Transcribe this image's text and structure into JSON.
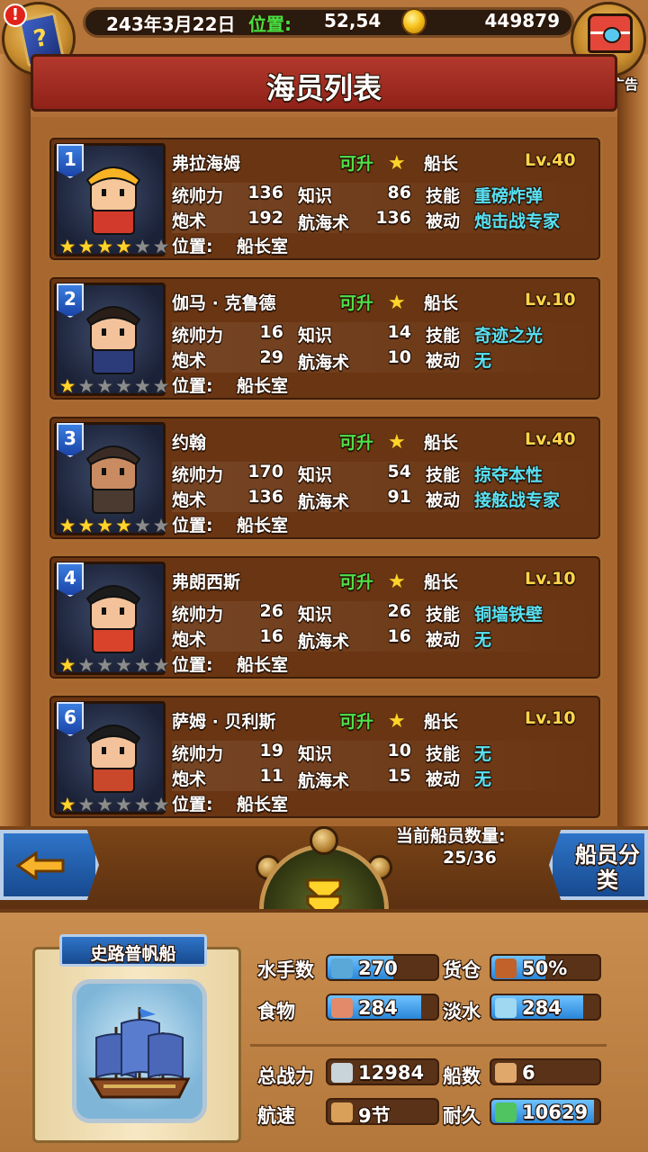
{
  "header": {
    "date": "243年3月22日",
    "position_label": "位置:",
    "position_value": "52,54",
    "gold": "449879",
    "ad_label": "有新广告",
    "alert": "!",
    "book_glyph": "?"
  },
  "title": "海员列表",
  "crew": [
    {
      "number": "1",
      "name": "弗拉海姆",
      "upgrade": "可升",
      "role": "船长",
      "level": "Lv.40",
      "stars": 4,
      "max_stars": 6,
      "command_label": "统帅力",
      "command": "136",
      "knowledge_label": "知识",
      "knowledge": "86",
      "skill_label": "技能",
      "skill": "重磅炸弹",
      "gunnery_label": "炮术",
      "gunnery": "192",
      "navigation_label": "航海术",
      "navigation": "136",
      "passive_label": "被动",
      "passive": "炮击战专家",
      "location_label": "位置:",
      "location": "船长室",
      "hair": "#f7b323",
      "skin": "#f6c79a",
      "outfit": "#d23a2c"
    },
    {
      "number": "2",
      "name": "伽马 · 克鲁德",
      "upgrade": "可升",
      "role": "船长",
      "level": "Lv.10",
      "stars": 1,
      "max_stars": 6,
      "command_label": "统帅力",
      "command": "16",
      "knowledge_label": "知识",
      "knowledge": "14",
      "skill_label": "技能",
      "skill": "奇迹之光",
      "gunnery_label": "炮术",
      "gunnery": "29",
      "navigation_label": "航海术",
      "navigation": "10",
      "passive_label": "被动",
      "passive": "无",
      "location_label": "位置:",
      "location": "船长室",
      "hair": "#2a1f18",
      "skin": "#f3c29a",
      "outfit": "#2c3b7a"
    },
    {
      "number": "3",
      "name": "约翰",
      "upgrade": "可升",
      "role": "船长",
      "level": "Lv.40",
      "stars": 4,
      "max_stars": 6,
      "command_label": "统帅力",
      "command": "170",
      "knowledge_label": "知识",
      "knowledge": "54",
      "skill_label": "技能",
      "skill": "掠夺本性",
      "gunnery_label": "炮术",
      "gunnery": "136",
      "navigation_label": "航海术",
      "navigation": "91",
      "passive_label": "被动",
      "passive": "接舷战专家",
      "location_label": "位置:",
      "location": "船长室",
      "hair": "#3a2c24",
      "skin": "#c98b62",
      "outfit": "#4a3a30"
    },
    {
      "number": "4",
      "name": "弗朗西斯",
      "upgrade": "可升",
      "role": "船长",
      "level": "Lv.10",
      "stars": 1,
      "max_stars": 6,
      "command_label": "统帅力",
      "command": "26",
      "knowledge_label": "知识",
      "knowledge": "26",
      "skill_label": "技能",
      "skill": "铜墙铁壁",
      "gunnery_label": "炮术",
      "gunnery": "16",
      "navigation_label": "航海术",
      "navigation": "16",
      "passive_label": "被动",
      "passive": "无",
      "location_label": "位置:",
      "location": "船长室",
      "hair": "#1c1c1c",
      "skin": "#f3c29a",
      "outfit": "#d9432b"
    },
    {
      "number": "6",
      "name": "萨姆 · 贝利斯",
      "upgrade": "可升",
      "role": "船长",
      "level": "Lv.10",
      "stars": 1,
      "max_stars": 6,
      "command_label": "统帅力",
      "command": "19",
      "knowledge_label": "知识",
      "knowledge": "10",
      "skill_label": "技能",
      "skill": "无",
      "gunnery_label": "炮术",
      "gunnery": "11",
      "navigation_label": "航海术",
      "navigation": "15",
      "passive_label": "被动",
      "passive": "无",
      "location_label": "位置:",
      "location": "船长室",
      "hair": "#1c1c1c",
      "skin": "#f3c29a",
      "outfit": "#c9482b"
    }
  ],
  "nav": {
    "crew_count_label": "当前船员数量:",
    "crew_count": "25/36",
    "classify_label": "船员分类"
  },
  "ship": {
    "name": "史路普帆船",
    "sailors_label": "水手数",
    "sailors": "270",
    "cargo_label": "货仓",
    "cargo": "50%",
    "food_label": "食物",
    "food": "284",
    "water_label": "淡水",
    "water": "284",
    "power_label": "总战力",
    "power": "12984",
    "ships_label": "船数",
    "ships": "6",
    "speed_label": "航速",
    "speed": "9节",
    "durability_label": "耐久",
    "durability": "10629",
    "bar_fill": {
      "sailors": 0.6,
      "cargo": 0.5,
      "food": 0.85,
      "water": 0.85,
      "durability": 0.95
    }
  },
  "colors": {
    "green": "#4fe04a",
    "yellow": "#ffd54a",
    "cyan": "#57e2f5",
    "banner_red": "#a82d22",
    "button_blue": "#2f74c8"
  },
  "icons": [
    "book-icon",
    "alert-icon",
    "gold-coin-icon",
    "treasure-chest-icon",
    "star-icon",
    "back-arrow-icon",
    "toggle-down-icon",
    "ship-icon",
    "sailor-icon",
    "cargo-icon",
    "food-icon",
    "water-icon",
    "power-icon",
    "ships-icon",
    "speed-icon",
    "durability-icon"
  ]
}
